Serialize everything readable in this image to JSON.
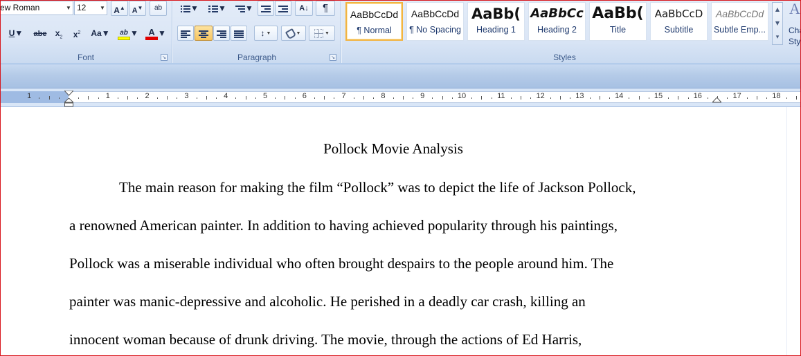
{
  "ribbon": {
    "font": {
      "label": "Font",
      "font_name": "ew Roman",
      "font_size": "12",
      "grow_font": "A",
      "shrink_font": "A",
      "clear_formatting": "ab",
      "underline": "U",
      "strikethrough": "abe",
      "subscript": "x",
      "superscript": "x",
      "change_case": "Aa",
      "highlight": "ab",
      "font_color": "A",
      "highlight_color": "#ffff00",
      "font_color_value": "#e00000"
    },
    "paragraph": {
      "label": "Paragraph",
      "show_marks": "¶",
      "sort": "A↓",
      "line_spacing": "↕"
    },
    "styles": {
      "label": "Styles",
      "items": [
        {
          "preview": "AaBbCcDd",
          "name": "¶ Normal",
          "selected": true
        },
        {
          "preview": "AaBbCcDd",
          "name": "¶ No Spacing",
          "selected": false
        },
        {
          "preview": "AaBb(",
          "name": "Heading 1",
          "selected": false
        },
        {
          "preview": "AaBbCc",
          "name": "Heading 2",
          "selected": false
        },
        {
          "preview": "AaBb(",
          "name": "Title",
          "selected": false
        },
        {
          "preview": "AaBbCcD",
          "name": "Subtitle",
          "selected": false
        },
        {
          "preview": "AaBbCcDd",
          "name": "Subtle Emp...",
          "selected": false
        }
      ],
      "change_styles_line1": "Cha",
      "change_styles_line2": "Sty"
    }
  },
  "ruler": {
    "numbers": [
      "1",
      "1",
      "2",
      "3",
      "4",
      "5",
      "6",
      "7",
      "8",
      "9",
      "10",
      "11",
      "12",
      "13",
      "14",
      "15",
      "16",
      "17",
      "18"
    ]
  },
  "document": {
    "title": "Pollock Movie Analysis",
    "lines": [
      "The main reason for making the film “Pollock” was to depict the life of Jackson Pollock,",
      "a renowned American painter. In addition to having achieved popularity through his paintings,",
      "Pollock was a miserable individual who often brought despairs to the people around him.  The",
      "painter was manic-depressive and alcoholic. He perished in a deadly car crash, killing an",
      "innocent woman because of drunk driving. The movie, through the actions of Ed Harris,"
    ]
  }
}
